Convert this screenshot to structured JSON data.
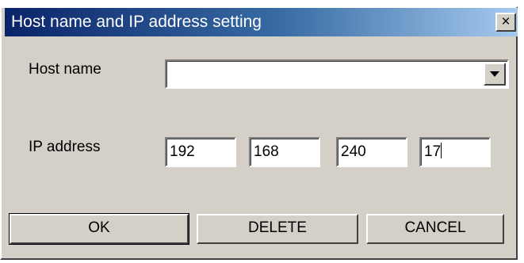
{
  "window": {
    "title": "Host name and IP address setting",
    "close_symbol": "×",
    "close_icon": "close-icon"
  },
  "host_name": {
    "label": "Host name",
    "value": "",
    "dropdown_icon": "chevron-down-icon"
  },
  "ip_address": {
    "label": "IP address",
    "octets": [
      "192",
      "168",
      "240",
      "17"
    ]
  },
  "buttons": {
    "ok": "OK",
    "delete": "DELETE",
    "cancel": "CANCEL"
  }
}
